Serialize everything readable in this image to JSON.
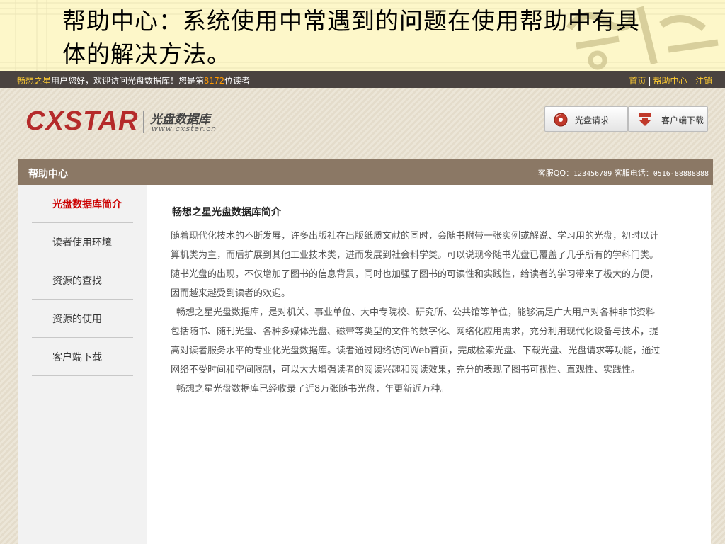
{
  "slide": {
    "title": "帮助中心：系统使用中常遇到的问题在使用帮助中有具体的解决方法。"
  },
  "top_bar": {
    "brand_name": "畅想之星",
    "greeting_pre": "用户您好，欢迎访问光盘数据库！您是第",
    "visitor_count": "8172",
    "greeting_post": "位读者",
    "links": [
      "首页",
      "帮助中心",
      "注销"
    ],
    "separator": "|"
  },
  "logo": {
    "brand": "CXSTAR",
    "cn_name": "光盘数据库",
    "url": "www.cxstar.cn"
  },
  "header_buttons": {
    "disc_request": "光盘请求",
    "client_download": "客户端下载"
  },
  "help_bar": {
    "title": "帮助中心",
    "qq_label": "客服QQ：",
    "qq": "123456789",
    "phone_label": "客服电话：",
    "phone": "0516-88888888"
  },
  "sidebar": {
    "items": [
      {
        "label": "光盘数据库简介"
      },
      {
        "label": "读者使用环境"
      },
      {
        "label": "资源的查找"
      },
      {
        "label": "资源的使用"
      },
      {
        "label": "客户端下载"
      }
    ]
  },
  "article": {
    "title": "畅想之星光盘数据库简介",
    "paragraphs": [
      "随着现代化技术的不断发展，许多出版社在出版纸质文献的同时，会随书附带一张实例或解说、学习用的光盘，初时以计算机类为主，而后扩展到其他工业技术类，进而发展到社会科学类。可以说现今随书光盘已覆盖了几乎所有的学科门类。随书光盘的出现，不仅增加了图书的信息背景，同时也加强了图书的可读性和实践性，给读者的学习带来了极大的方便，因而越来越受到读者的欢迎。",
      "畅想之星光盘数据库，是对机关、事业单位、大中专院校、研究所、公共馆等单位，能够满足广大用户对各种非书资料包括随书、随刊光盘、各种多媒体光盘、磁带等类型的文件的数字化、网络化应用需求，充分利用现代化设备与技术，提高对读者服务水平的专业化光盘数据库。读者通过网络访问Web首页，完成检索光盘、下载光盘、光盘请求等功能，通过网络不受时间和空间限制，可以大大增强读者的阅读兴趣和阅读效果，充分的表现了图书可视性、直观性、实践性。",
      "畅想之星光盘数据库已经收录了近8万张随书光盘，年更新近万种。"
    ]
  },
  "icons": {
    "disc": "disc-icon",
    "download": "download-icon"
  },
  "colors": {
    "slide_bg": "#fdf7c9",
    "top_bar": "#4a4340",
    "highlight": "#ffcc33",
    "brand_red": "#b52a2a",
    "help_bar": "#8b7865",
    "active_nav": "#cc0000"
  }
}
